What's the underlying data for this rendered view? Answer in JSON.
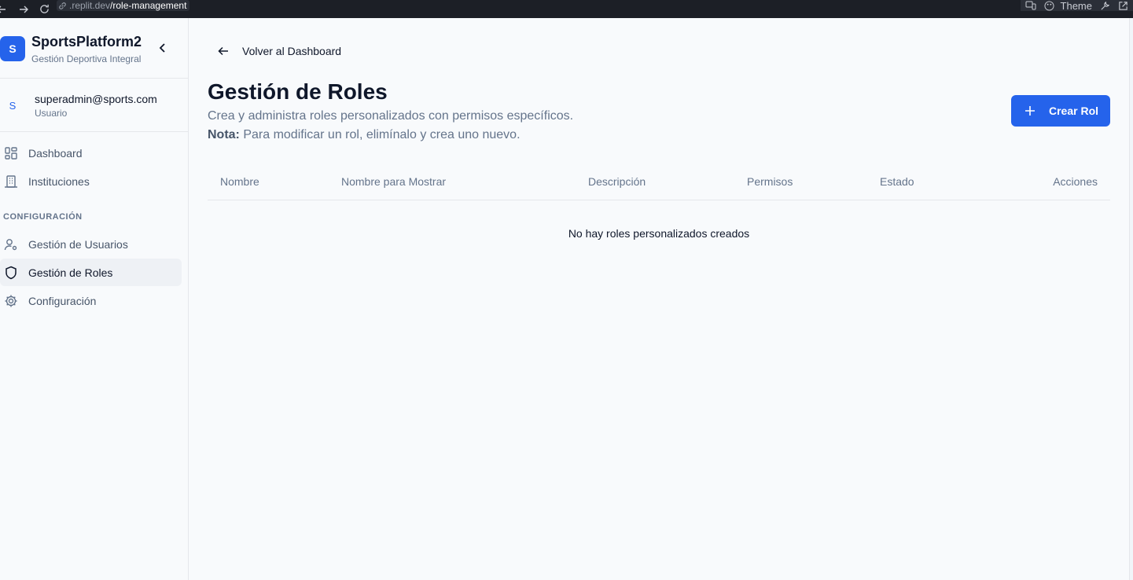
{
  "browser": {
    "url_prefix": ".replit.dev",
    "url_path": "/role-management",
    "theme_label": "Theme"
  },
  "sidebar": {
    "brand_initial": "S",
    "brand_name": "SportsPlatform2",
    "brand_subtitle": "Gestión Deportiva Integral",
    "user_initial": "S",
    "user_email": "superadmin@sports.com",
    "user_role": "Usuario",
    "items": [
      {
        "label": "Dashboard",
        "icon": "layout-dashboard-icon"
      },
      {
        "label": "Instituciones",
        "icon": "building-icon"
      }
    ],
    "section_label": "CONFIGURACIÓN",
    "config_items": [
      {
        "label": "Gestión de Usuarios",
        "icon": "user-cog-icon"
      },
      {
        "label": "Gestión de Roles",
        "icon": "shield-icon",
        "active": true
      },
      {
        "label": "Configuración",
        "icon": "settings-icon"
      }
    ]
  },
  "main": {
    "back_label": "Volver al Dashboard",
    "title": "Gestión de Roles",
    "description": "Crea y administra roles personalizados con permisos específicos.",
    "note_bold": "Nota:",
    "note_text": " Para modificar un rol, elimínalo y crea uno nuevo.",
    "create_button": "Crear Rol",
    "table": {
      "columns": [
        "Nombre",
        "Nombre para Mostrar",
        "Descripción",
        "Permisos",
        "Estado",
        "Acciones"
      ],
      "empty_message": "No hay roles personalizados creados"
    }
  },
  "colors": {
    "accent": "#2563eb",
    "text": "#0f172a",
    "muted": "#64748b"
  }
}
